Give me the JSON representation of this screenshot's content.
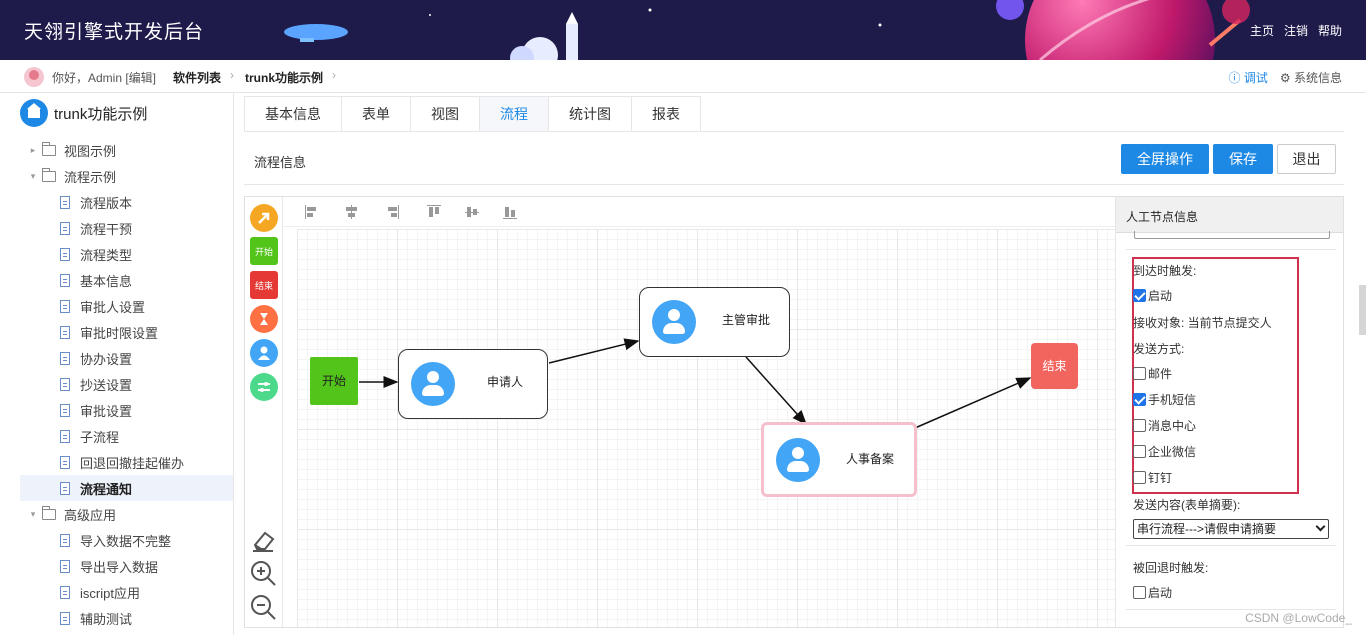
{
  "header": {
    "app_title": "天翎引擎式开发后台",
    "links": [
      "主页",
      "注销",
      "帮助"
    ]
  },
  "breadcrumb": {
    "greeting": "你好，Admin [编辑]",
    "items": [
      "软件列表",
      "trunk功能示例"
    ],
    "debug": "调试",
    "sysinfo": "系统信息"
  },
  "sidebar": {
    "home": "trunk功能示例",
    "items": [
      {
        "label": "视图示例",
        "type": "folder",
        "caret": "▸"
      },
      {
        "label": "流程示例",
        "type": "folder",
        "caret": "▾"
      },
      {
        "label": "流程版本",
        "type": "file"
      },
      {
        "label": "流程干预",
        "type": "file"
      },
      {
        "label": "流程类型",
        "type": "file"
      },
      {
        "label": "基本信息",
        "type": "file"
      },
      {
        "label": "审批人设置",
        "type": "file"
      },
      {
        "label": "审批时限设置",
        "type": "file"
      },
      {
        "label": "协办设置",
        "type": "file"
      },
      {
        "label": "抄送设置",
        "type": "file"
      },
      {
        "label": "审批设置",
        "type": "file"
      },
      {
        "label": "子流程",
        "type": "file"
      },
      {
        "label": "回退回撤挂起催办",
        "type": "file"
      },
      {
        "label": "流程通知",
        "type": "file",
        "active": true
      },
      {
        "label": "高级应用",
        "type": "folder",
        "caret": "▾"
      },
      {
        "label": "导入数据不完整",
        "type": "file"
      },
      {
        "label": "导出导入数据",
        "type": "file"
      },
      {
        "label": "iscript应用",
        "type": "file"
      },
      {
        "label": "辅助测试",
        "type": "file"
      }
    ]
  },
  "tabs": [
    "基本信息",
    "表单",
    "视图",
    "流程",
    "统计图",
    "报表"
  ],
  "active_tab": "流程",
  "main": {
    "section_title": "流程信息",
    "fullscreen_label": "全屏操作",
    "save_label": "保存",
    "exit_label": "退出"
  },
  "palette": {
    "start": "开始",
    "end": "结束"
  },
  "flow": {
    "start": "开始",
    "applicant": "申请人",
    "manager": "主管审批",
    "hr": "人事备案",
    "end": "结束"
  },
  "panel": {
    "title": "人工节点信息",
    "select_stub": "select",
    "arrival_trigger": "到达时触发:",
    "enable": "启动",
    "receiver": "接收对象: 当前节点提交人",
    "send_method": "发送方式:",
    "methods": [
      {
        "label": "邮件",
        "checked": false
      },
      {
        "label": "手机短信",
        "checked": true
      },
      {
        "label": "消息中心",
        "checked": false
      },
      {
        "label": "企业微信",
        "checked": false
      },
      {
        "label": "钉钉",
        "checked": false
      }
    ],
    "content_label": "发送内容(表单摘要):",
    "content_value": "串行流程--->请假申请摘要",
    "rollback_trigger": "被回退时触发:",
    "rollback_enable": "启动"
  },
  "watermark": "CSDN @LowCode_",
  "colors": {
    "primary": "#1e88e5",
    "header_bg": "#1e1b4b",
    "start_node": "#52c41a",
    "end_node": "#f2655f",
    "highlight_box": "#d0314f"
  }
}
